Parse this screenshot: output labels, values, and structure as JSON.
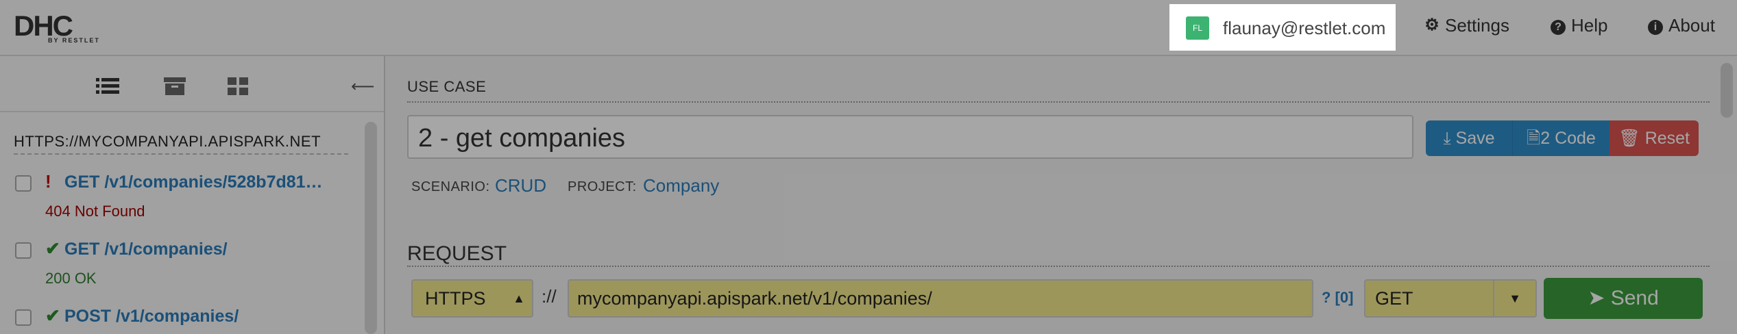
{
  "header": {
    "logo_big": "DHC",
    "logo_small": "BY RESTLET",
    "user_avatar": "FL",
    "user_email": "flaunay@restlet.com",
    "settings_label": "Settings",
    "help_label": "Help",
    "about_label": "About"
  },
  "sidebar": {
    "host": "HTTPS://MYCOMPANYAPI.APISPARK.NET",
    "items": [
      {
        "method_path": "GET /v1/companies/528b7d81…",
        "status": "404 Not Found",
        "mark": "!",
        "mark_color": "#c00000",
        "status_color": "#a30000"
      },
      {
        "method_path": "GET /v1/companies/",
        "status": "200 OK",
        "mark": "✔",
        "mark_color": "#2e8b2e",
        "status_color": "#2e7d2e"
      },
      {
        "method_path": "POST /v1/companies/",
        "status": "",
        "mark": "✔",
        "mark_color": "#2e8b2e",
        "status_color": "#2e7d2e"
      }
    ]
  },
  "usecase": {
    "label": "USE CASE",
    "name": "2 - get companies",
    "save_label": "Save",
    "code_label": "2 Code",
    "reset_label": "Reset",
    "scenario_label": "SCENARIO:",
    "scenario_value": "CRUD",
    "project_label": "PROJECT:",
    "project_value": "Company"
  },
  "request": {
    "label": "REQUEST",
    "scheme": "HTTPS",
    "separator": "://",
    "url": "mycompanyapi.apispark.net/v1/companies/",
    "query_count": "? [0]",
    "method": "GET",
    "send_label": "Send"
  },
  "colors": {
    "accent_blue": "#2e8dc8",
    "danger_red": "#d9534f",
    "send_green": "#3c9a3c",
    "field_yellow": "#f0e68c"
  }
}
